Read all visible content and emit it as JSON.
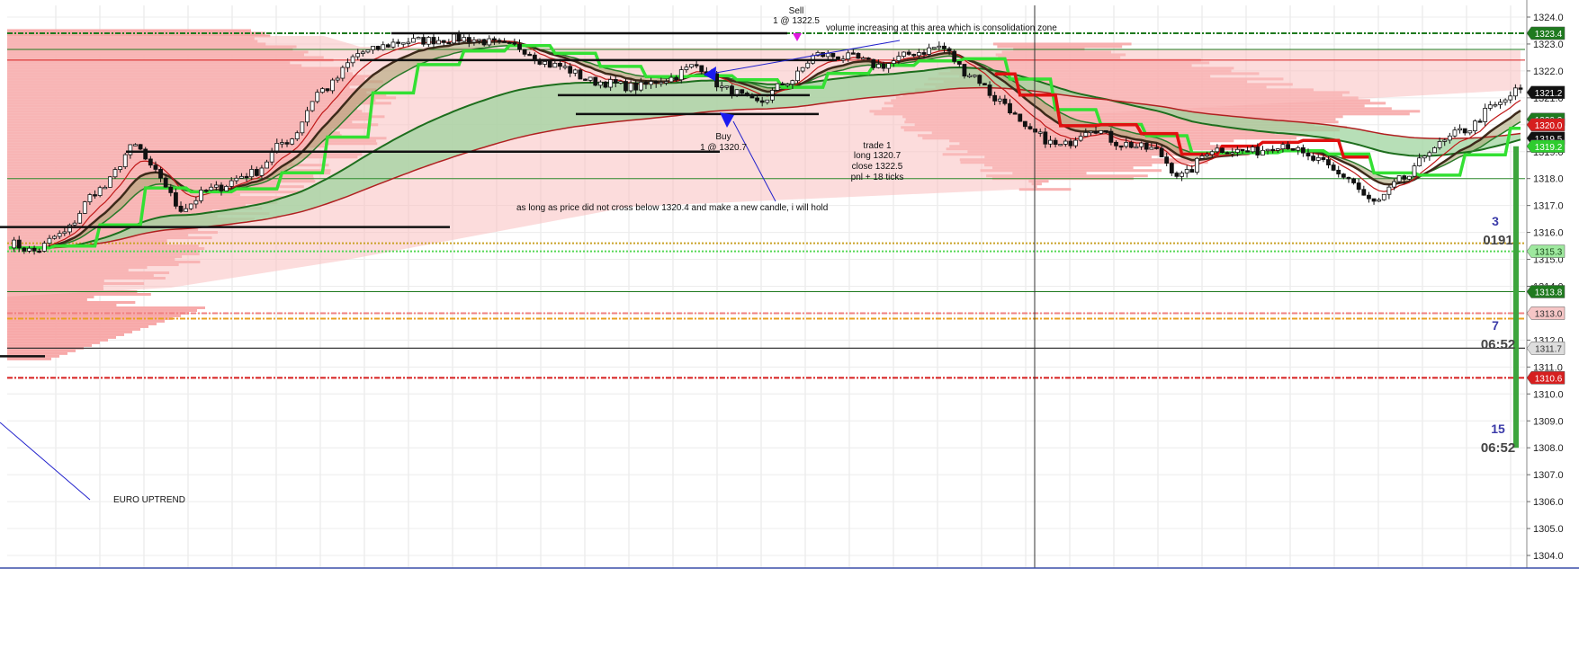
{
  "chart_data": {
    "type": "candlestick",
    "instrument_note": "EURO UPTREND",
    "y_axis": {
      "ticks": [
        "1324.0",
        "1323.0",
        "1322.0",
        "1321.0",
        "1320.0",
        "1319.0",
        "1318.0",
        "1317.0",
        "1316.0",
        "1315.0",
        "1314.0",
        "1313.0",
        "1312.0",
        "1311.0",
        "1310.0",
        "1309.0",
        "1308.0",
        "1307.0",
        "1306.0",
        "1305.0",
        "1304.0"
      ],
      "ylim": [
        1303.9,
        1324.4
      ]
    },
    "price_tags": [
      {
        "label": "1323.4",
        "value": 1323.4,
        "bg": "#1f7a1f",
        "fg": "#ffffff"
      },
      {
        "label": "1321.2",
        "value": 1321.2,
        "bg": "#111111",
        "fg": "#ffffff"
      },
      {
        "label": "1320.2",
        "value": 1320.2,
        "bg": "#1f7a1f",
        "fg": "#ffffff"
      },
      {
        "label": "1320.0",
        "value": 1320.0,
        "bg": "#d61f1f",
        "fg": "#ffffff"
      },
      {
        "label": "1319.5",
        "value": 1319.5,
        "bg": "#111111",
        "fg": "#ffffff"
      },
      {
        "label": "1319.2",
        "value": 1319.2,
        "bg": "#2fcc2f",
        "fg": "#ffffff"
      },
      {
        "label": "1315.3",
        "value": 1315.3,
        "bg": "#9ee89e",
        "fg": "#1d4d1d"
      },
      {
        "label": "1313.8",
        "value": 1313.8,
        "bg": "#1f7a1f",
        "fg": "#ffffff"
      },
      {
        "label": "1313.0",
        "value": 1313.0,
        "bg": "#f6c6c6",
        "fg": "#333333"
      },
      {
        "label": "1311.7",
        "value": 1311.7,
        "bg": "#dddddd",
        "fg": "#333333"
      },
      {
        "label": "1310.6",
        "value": 1310.6,
        "bg": "#d61f1f",
        "fg": "#ffffff"
      }
    ],
    "horizontal_levels": [
      {
        "value": 1323.4,
        "color": "#1f7a1f",
        "style": "dash-dot"
      },
      {
        "value": 1322.8,
        "color": "#1f7a1f",
        "style": "solid"
      },
      {
        "value": 1322.4,
        "color": "#d61f1f",
        "style": "solid"
      },
      {
        "value": 1318.0,
        "color": "#2e8b2e",
        "style": "solid"
      },
      {
        "value": 1315.3,
        "color": "#55d655",
        "style": "dotted"
      },
      {
        "value": 1315.6,
        "color": "#c9a227",
        "style": "dotted"
      },
      {
        "value": 1313.8,
        "color": "#1f7a1f",
        "style": "solid"
      },
      {
        "value": 1313.0,
        "color": "#f08080",
        "style": "dash-dot"
      },
      {
        "value": 1312.8,
        "color": "#e8a020",
        "style": "dash-dot"
      },
      {
        "value": 1311.7,
        "color": "#111111",
        "style": "solid"
      },
      {
        "value": 1310.6,
        "color": "#d61f1f",
        "style": "dash-dot"
      }
    ],
    "annotations": {
      "sell_title": "Sell",
      "sell_detail": "1 @ 1322.5",
      "buy_title": "Buy",
      "buy_detail": "1 @ 1320.7",
      "volume_note": "volume increasing at this area which is consolidation zone",
      "trade_line1": "trade 1",
      "trade_line2": "long 1320.7",
      "trade_line3": "close 1322.5",
      "trade_line4": "pnl + 18 ticks",
      "hold_note": "as long as price did not cross below 1320.4 and make a new candle, i will hold",
      "trend_note": "EURO UPTREND"
    },
    "timers": [
      {
        "num": "3",
        "time": "0191"
      },
      {
        "num": "7",
        "time": "06:52"
      },
      {
        "num": "15",
        "time": "06:52"
      }
    ],
    "colors": {
      "up_candle": "#ffffff",
      "down_candle": "#111111",
      "volume_profile": "#f7a9a9",
      "cloud_green": "#9fd49f",
      "cloud_brown": "#a8a070",
      "fast_ma": "#33e033",
      "dark_ma": "#3d2a1a",
      "red_ma": "#e01010"
    }
  }
}
